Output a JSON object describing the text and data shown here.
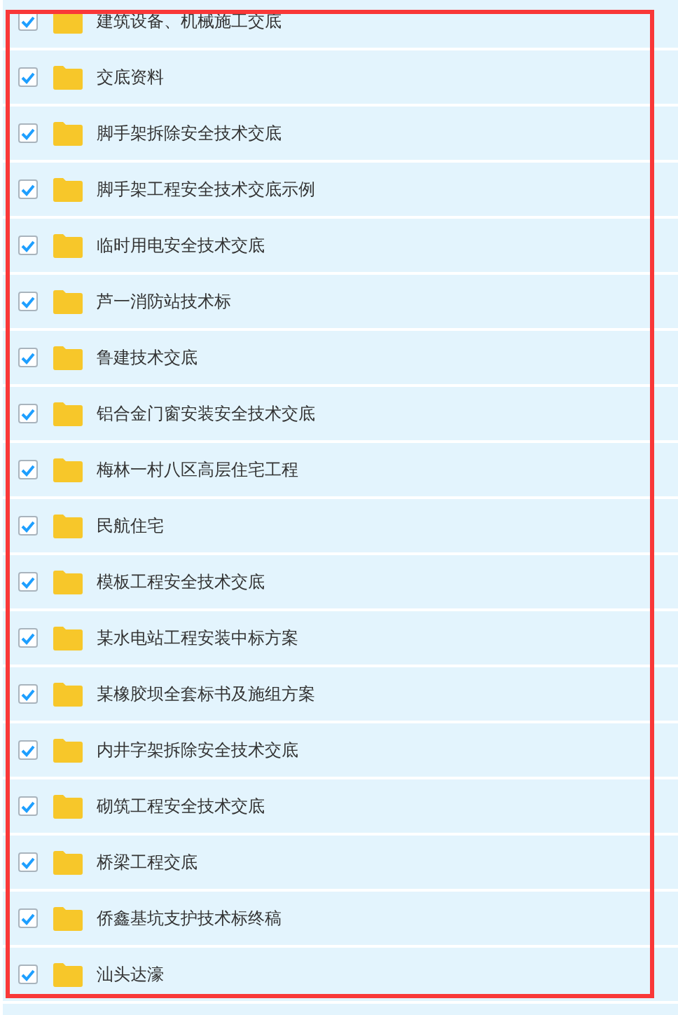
{
  "items": [
    {
      "label": "建筑设备、机械施工交底",
      "checked": true
    },
    {
      "label": "交底资料",
      "checked": true
    },
    {
      "label": "脚手架拆除安全技术交底",
      "checked": true
    },
    {
      "label": "脚手架工程安全技术交底示例",
      "checked": true
    },
    {
      "label": "临时用电安全技术交底",
      "checked": true
    },
    {
      "label": "芦一消防站技术标",
      "checked": true
    },
    {
      "label": "鲁建技术交底",
      "checked": true
    },
    {
      "label": "铝合金门窗安装安全技术交底",
      "checked": true
    },
    {
      "label": "梅林一村八区高层住宅工程",
      "checked": true
    },
    {
      "label": "民航住宅",
      "checked": true
    },
    {
      "label": "模板工程安全技术交底",
      "checked": true
    },
    {
      "label": "某水电站工程安装中标方案",
      "checked": true
    },
    {
      "label": "某橡胶坝全套标书及施组方案",
      "checked": true
    },
    {
      "label": "内井字架拆除安全技术交底",
      "checked": true
    },
    {
      "label": "砌筑工程安全技术交底",
      "checked": true
    },
    {
      "label": "桥梁工程交底",
      "checked": true
    },
    {
      "label": "侨鑫基坑支护技术标终稿",
      "checked": true
    },
    {
      "label": "汕头达濠",
      "checked": true
    }
  ]
}
